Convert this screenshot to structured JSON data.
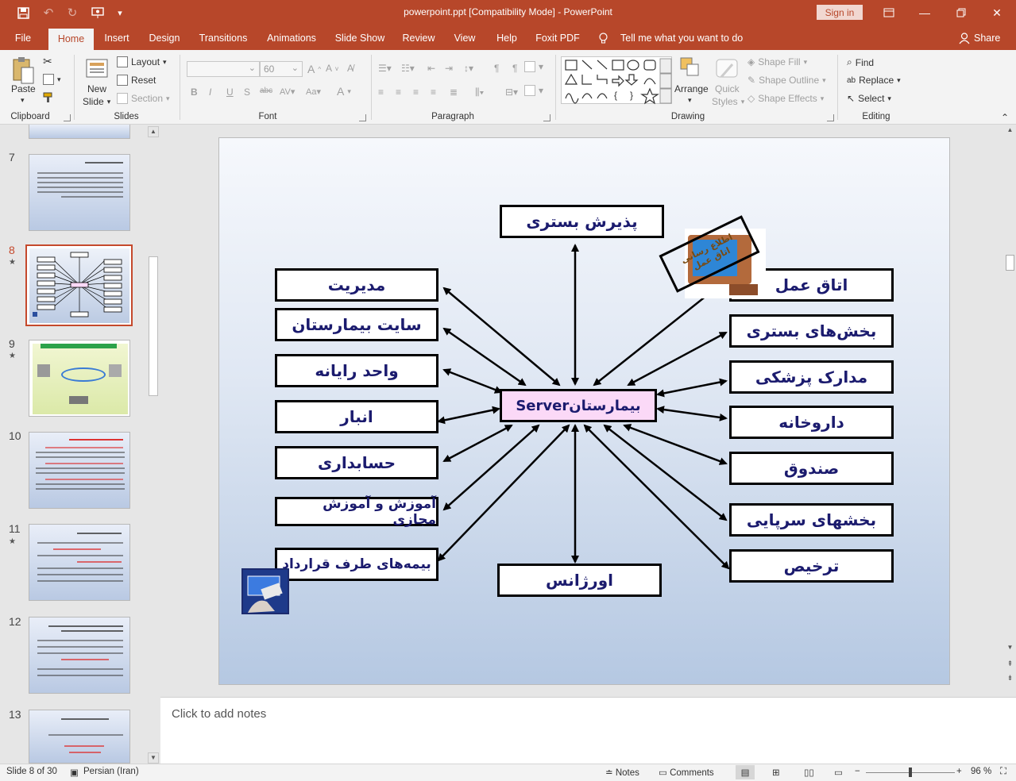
{
  "window": {
    "title": "powerpoint.ppt [Compatibility Mode]  -  PowerPoint",
    "sign_in": "Sign in"
  },
  "ribbon_tabs": [
    "File",
    "Home",
    "Insert",
    "Design",
    "Transitions",
    "Animations",
    "Slide Show",
    "Review",
    "View",
    "Help",
    "Foxit PDF"
  ],
  "tell_me": "Tell me what you want to do",
  "share": "Share",
  "ribbon": {
    "clipboard": {
      "label": "Clipboard",
      "paste": "Paste"
    },
    "slides": {
      "label": "Slides",
      "new_slide_1": "New",
      "new_slide_2": "Slide",
      "layout": "Layout",
      "reset": "Reset",
      "section": "Section"
    },
    "font": {
      "label": "Font",
      "size": "60"
    },
    "paragraph": {
      "label": "Paragraph"
    },
    "drawing": {
      "label": "Drawing",
      "arrange": "Arrange",
      "quick_styles_1": "Quick",
      "quick_styles_2": "Styles",
      "shape_fill": "Shape Fill",
      "shape_outline": "Shape Outline",
      "shape_effects": "Shape Effects"
    },
    "editing": {
      "label": "Editing",
      "find": "Find",
      "replace": "Replace",
      "select": "Select"
    }
  },
  "thumbnails": [
    {
      "num": "7",
      "star": ""
    },
    {
      "num": "8",
      "star": "★"
    },
    {
      "num": "9",
      "star": "★"
    },
    {
      "num": "10",
      "star": ""
    },
    {
      "num": "11",
      "star": "★"
    },
    {
      "num": "12",
      "star": ""
    },
    {
      "num": "13",
      "star": ""
    }
  ],
  "slide": {
    "server": "بیمارستانServer",
    "left_boxes": [
      "مدیریت",
      "سایت بیمارستان",
      "واحد رایانه",
      "انبار",
      "حسابداری",
      "آموزش و آموزش مجازی",
      "بیمه‌های طرف قرارداد"
    ],
    "right_boxes": [
      "اتاق عمل",
      "بخش‌های بستری",
      "مدارک پزشکی",
      "داروخانه",
      "صندوق",
      "بخشهای سرپایی",
      "ترخیص"
    ],
    "top_box": "پذیرش بستری",
    "bottom_box": "اورژانس",
    "computer_label": "اطلاع رسانی اتاق عمل"
  },
  "notes_placeholder": "Click to add notes",
  "status": {
    "slide_info": "Slide 8 of 30",
    "language": "Persian (Iran)",
    "notes": "Notes",
    "comments": "Comments",
    "zoom": "96 %"
  }
}
